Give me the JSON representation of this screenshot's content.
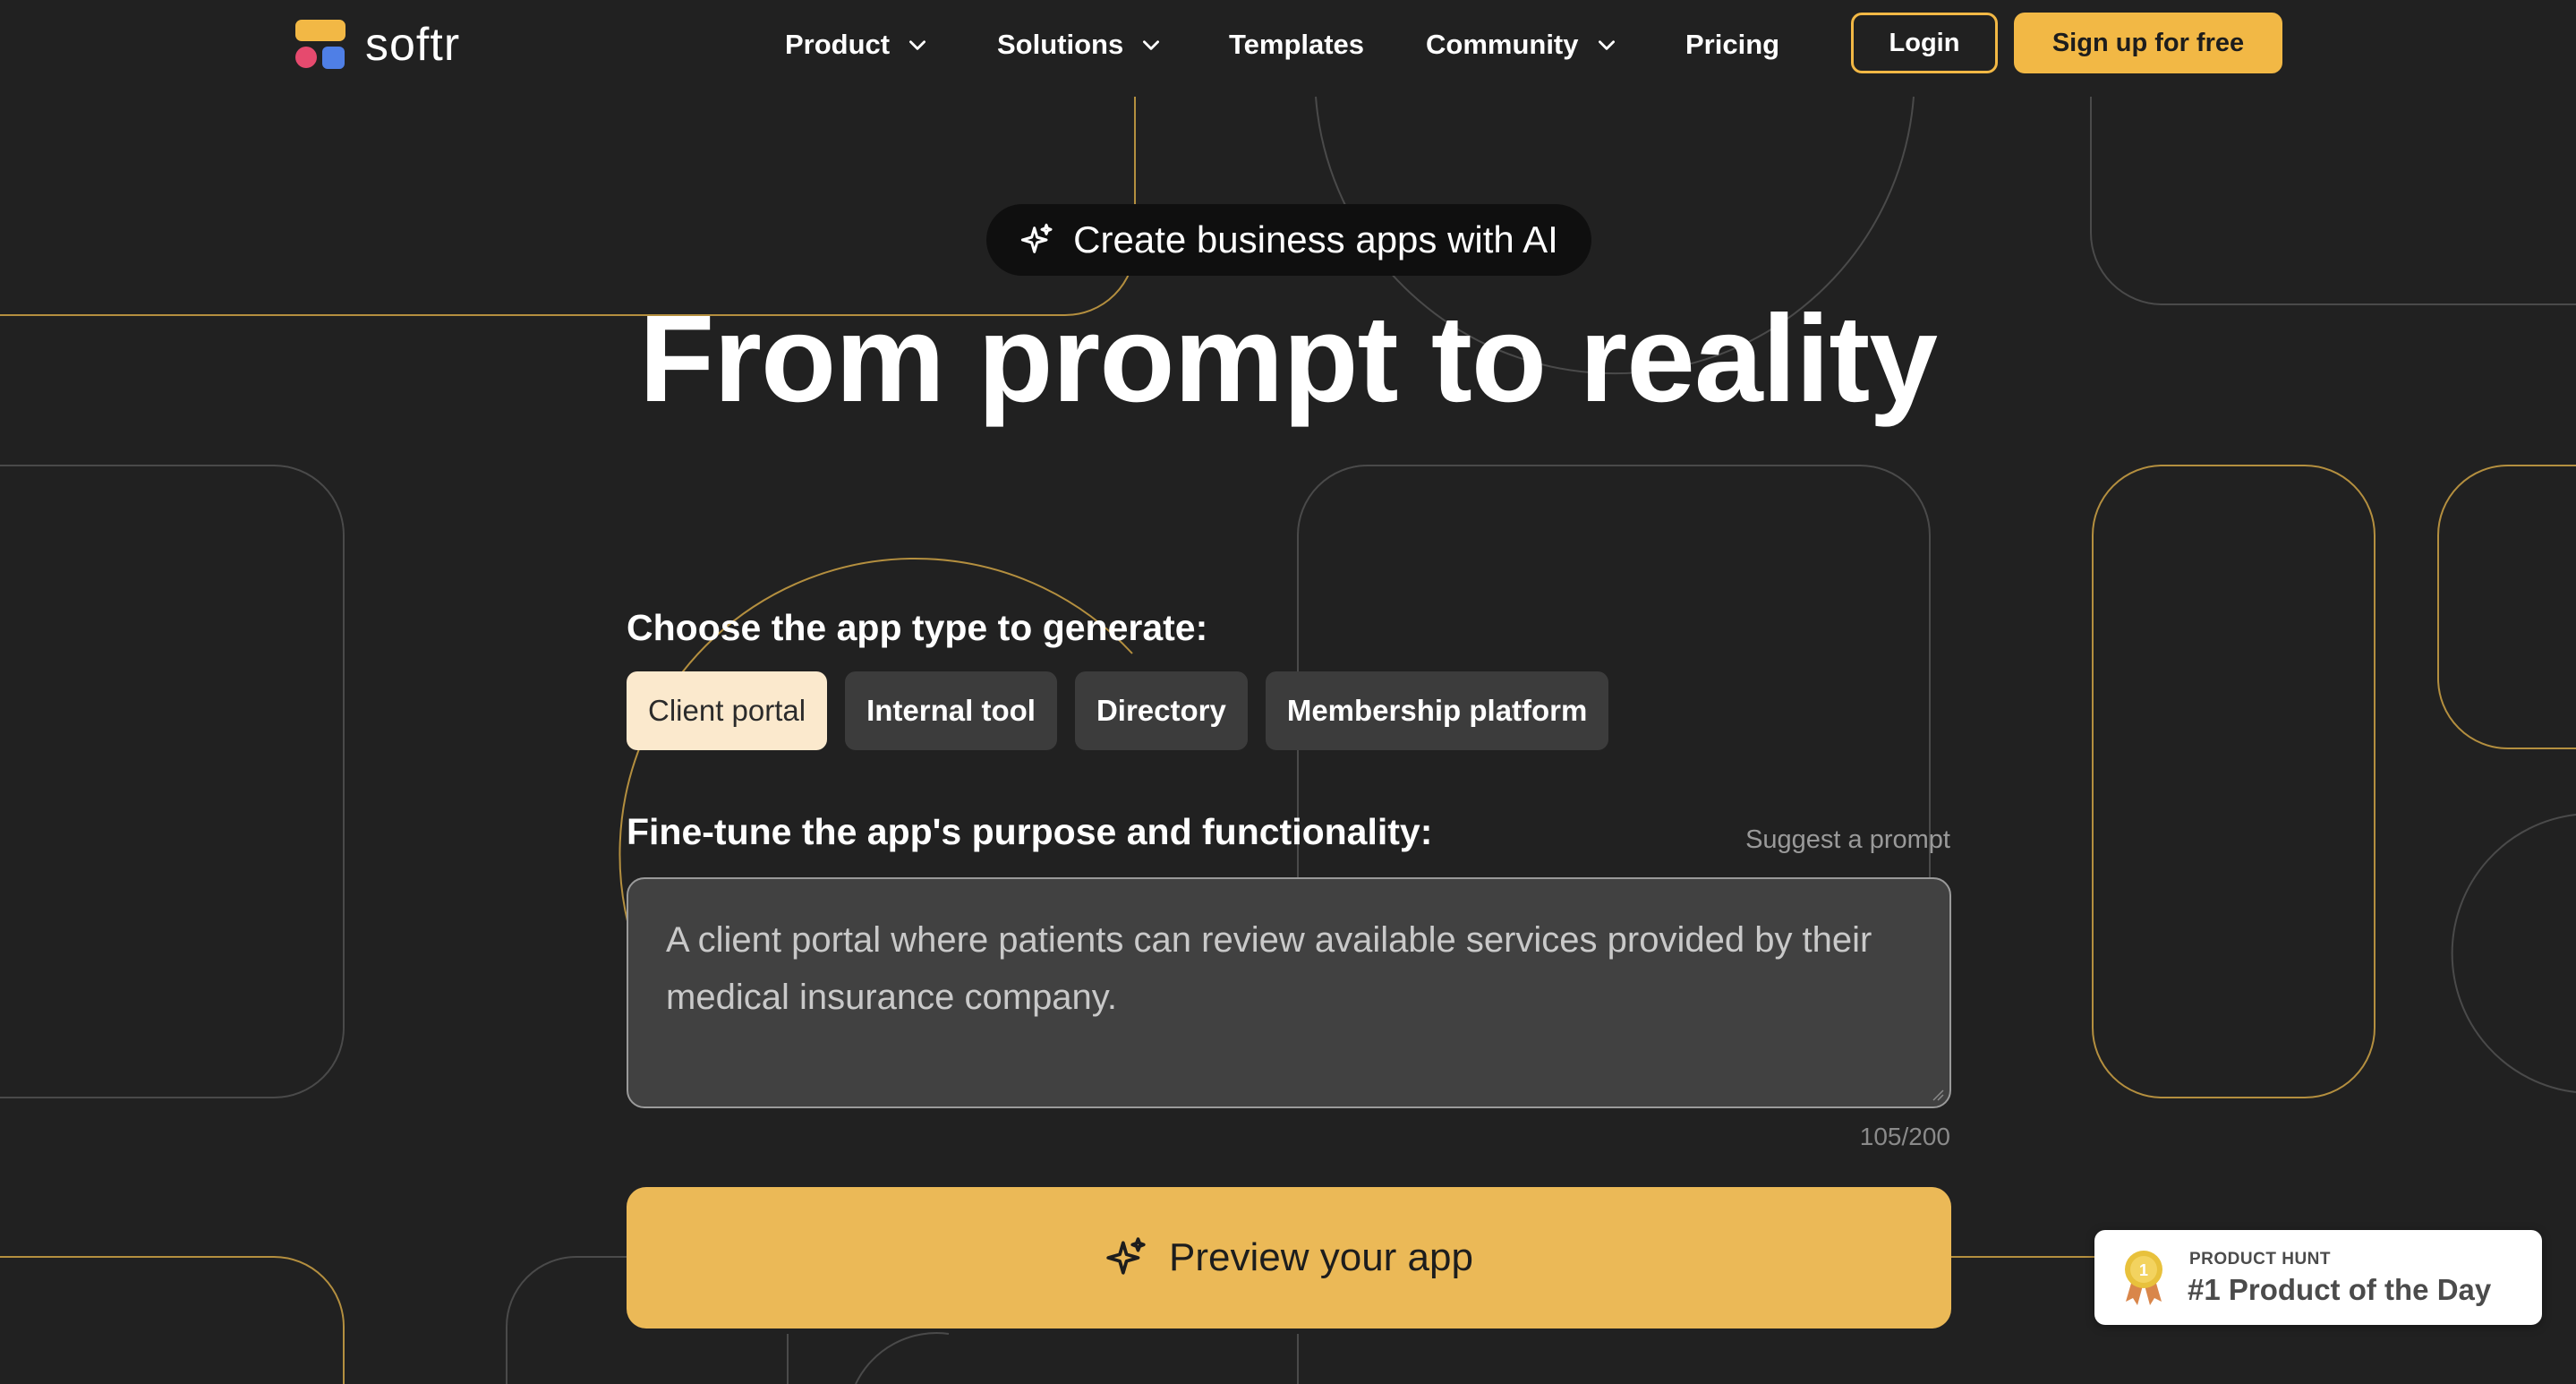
{
  "brand": {
    "name": "softr",
    "colors": {
      "accent": "#f2b845",
      "red": "#e64a6e",
      "blue": "#4f7fe6"
    }
  },
  "nav": {
    "items": [
      {
        "label": "Product",
        "has_dropdown": true
      },
      {
        "label": "Solutions",
        "has_dropdown": true
      },
      {
        "label": "Templates",
        "has_dropdown": false
      },
      {
        "label": "Community",
        "has_dropdown": true
      },
      {
        "label": "Pricing",
        "has_dropdown": false
      }
    ],
    "login_label": "Login",
    "signup_label": "Sign up for free"
  },
  "hero": {
    "badge_icon": "sparkles-icon",
    "badge_text": "Create business apps with AI",
    "title": "From prompt to reality"
  },
  "generator": {
    "choose_label": "Choose the app type to generate:",
    "app_types": [
      {
        "label": "Client portal",
        "selected": true
      },
      {
        "label": "Internal tool",
        "selected": false
      },
      {
        "label": "Directory",
        "selected": false
      },
      {
        "label": "Membership platform",
        "selected": false
      }
    ],
    "finetune_label": "Fine-tune the app's purpose and functionality:",
    "suggest_label": "Suggest a prompt",
    "prompt_text": "A client portal where patients can review available services provided by their medical insurance company.",
    "char_count": "105/200",
    "preview_icon": "sparkles-icon",
    "preview_label": "Preview your app"
  },
  "product_hunt": {
    "icon": "medal-icon",
    "kicker": "PRODUCT HUNT",
    "title": "#1 Product of the Day"
  }
}
